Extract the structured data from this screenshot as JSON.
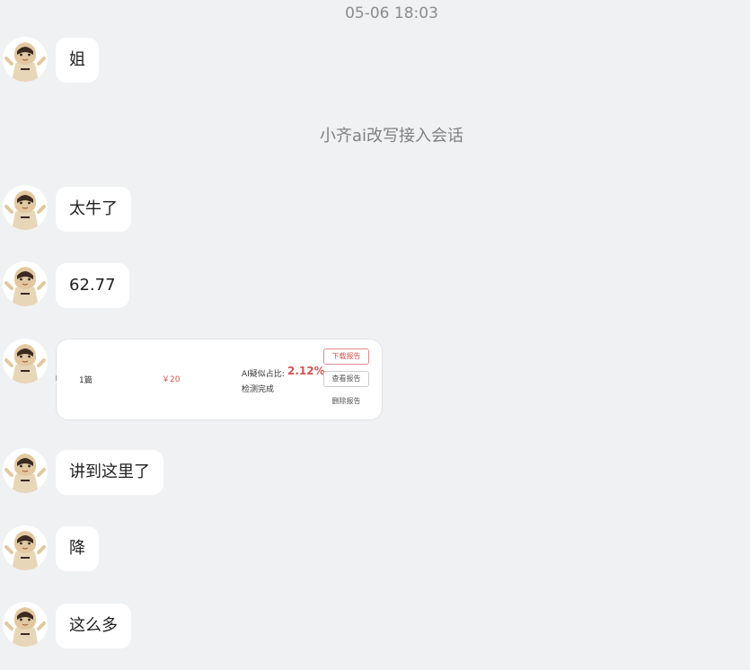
{
  "conversation": {
    "timestamp": "05-06 18:03",
    "system_note": "小齐ai改写接入会话"
  },
  "messages": [
    {
      "text": "姐"
    },
    {
      "text": "太牛了"
    },
    {
      "text": "62.77"
    },
    {
      "text": "讲到这里了"
    },
    {
      "text": "降"
    },
    {
      "text": "这么多"
    }
  ],
  "report_card": {
    "count": "1篇",
    "price": "￥20",
    "ai_label": "AI疑似占比:",
    "ai_value": "2.12%",
    "status": "检测完成",
    "download_label": "下载报告",
    "view_label": "查看报告",
    "delete_label": "删除报告"
  },
  "colors": {
    "background": "#f0f1f3",
    "bubble": "#ffffff",
    "accent_red": "#d9534f"
  },
  "icons": {
    "avatar": "cartoon-girl-avatar-icon"
  }
}
